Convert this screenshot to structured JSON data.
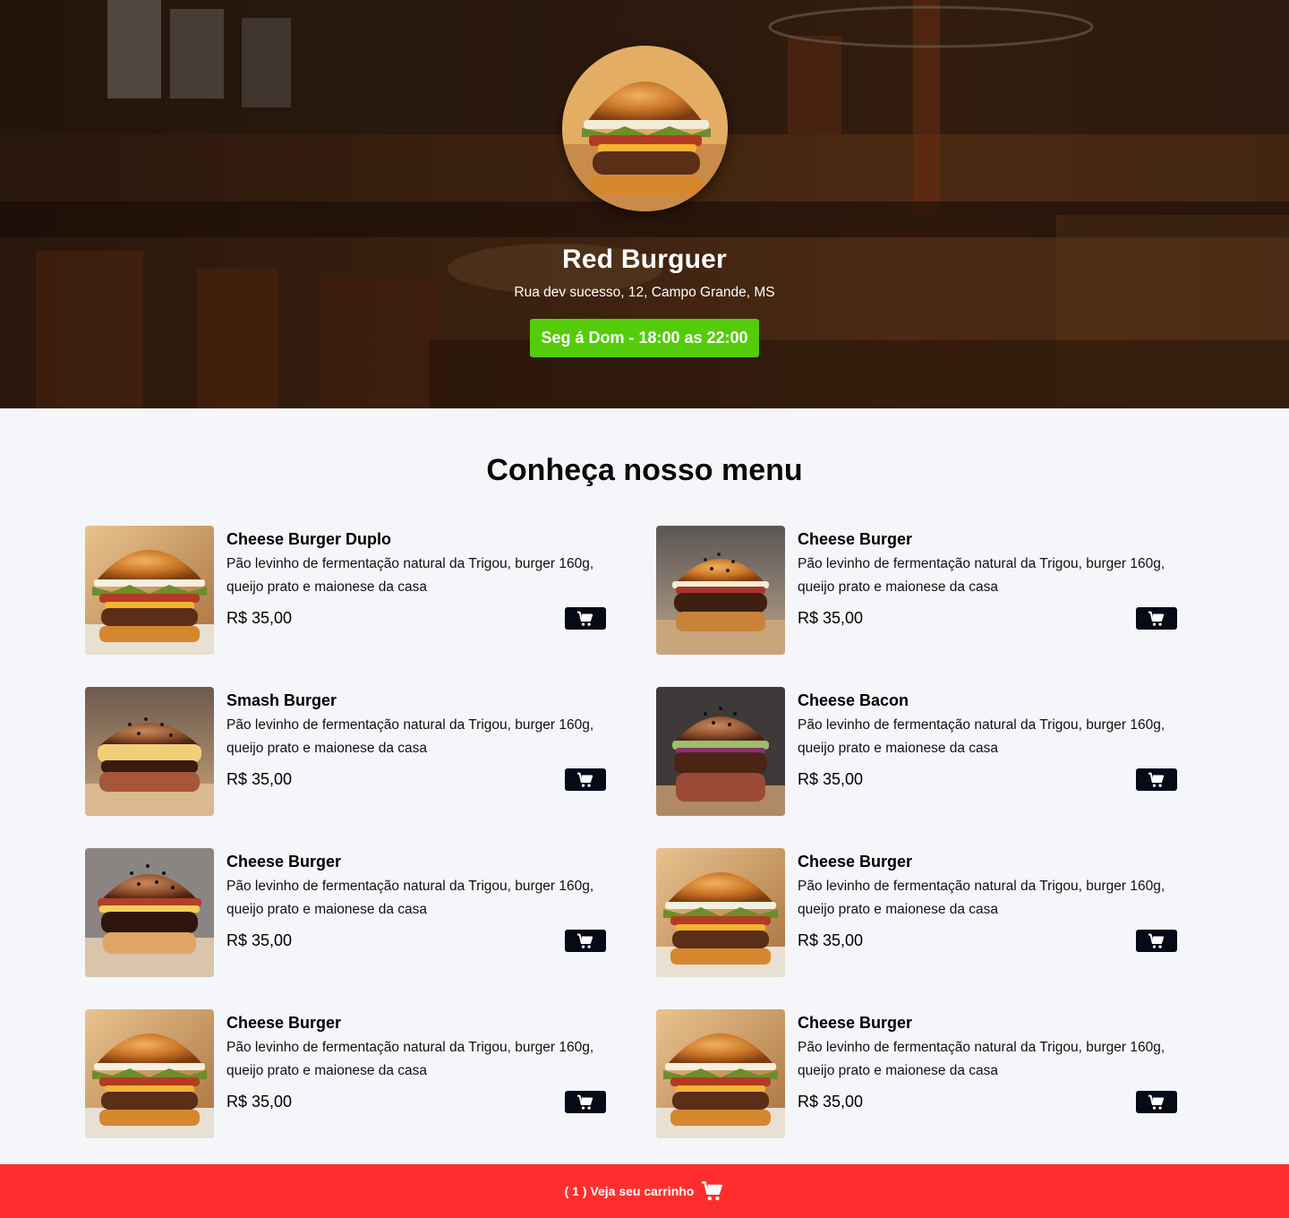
{
  "restaurant": {
    "name": "Red Burguer",
    "address": "Rua dev sucesso, 12, Campo Grande, MS",
    "hours": "Seg á Dom - 18:00 as 22:00"
  },
  "menu": {
    "title": "Conheça nosso menu",
    "items": [
      {
        "name": "Cheese Burger Duplo",
        "description": "Pão levinho de fermentação natural da Trigou, burger 160g, queijo prato e maionese da casa",
        "price": "R$ 35,00"
      },
      {
        "name": "Cheese Burger",
        "description": "Pão levinho de fermentação natural da Trigou, burger 160g, queijo prato e maionese da casa",
        "price": "R$ 35,00"
      },
      {
        "name": "Smash Burger",
        "description": "Pão levinho de fermentação natural da Trigou, burger 160g, queijo prato e maionese da casa",
        "price": "R$ 35,00"
      },
      {
        "name": "Cheese Bacon",
        "description": "Pão levinho de fermentação natural da Trigou, burger 160g, queijo prato e maionese da casa",
        "price": "R$ 35,00"
      },
      {
        "name": "Cheese Burger",
        "description": "Pão levinho de fermentação natural da Trigou, burger 160g, queijo prato e maionese da casa",
        "price": "R$ 35,00"
      },
      {
        "name": "Cheese Burger",
        "description": "Pão levinho de fermentação natural da Trigou, burger 160g, queijo prato e maionese da casa",
        "price": "R$ 35,00"
      },
      {
        "name": "Cheese Burger",
        "description": "Pão levinho de fermentação natural da Trigou, burger 160g, queijo prato e maionese da casa",
        "price": "R$ 35,00"
      },
      {
        "name": "Cheese Burger",
        "description": "Pão levinho de fermentação natural da Trigou, burger 160g, queijo prato e maionese da casa",
        "price": "R$ 35,00"
      }
    ]
  },
  "cart": {
    "label": "( 1 ) Veja seu carrinho",
    "icon": "shopping-cart-icon"
  },
  "colors": {
    "hours_badge": "#54cc0a",
    "cart_bar": "#ff2e2e",
    "cart_button": "#060a17",
    "page_background": "#f4f6f9"
  }
}
